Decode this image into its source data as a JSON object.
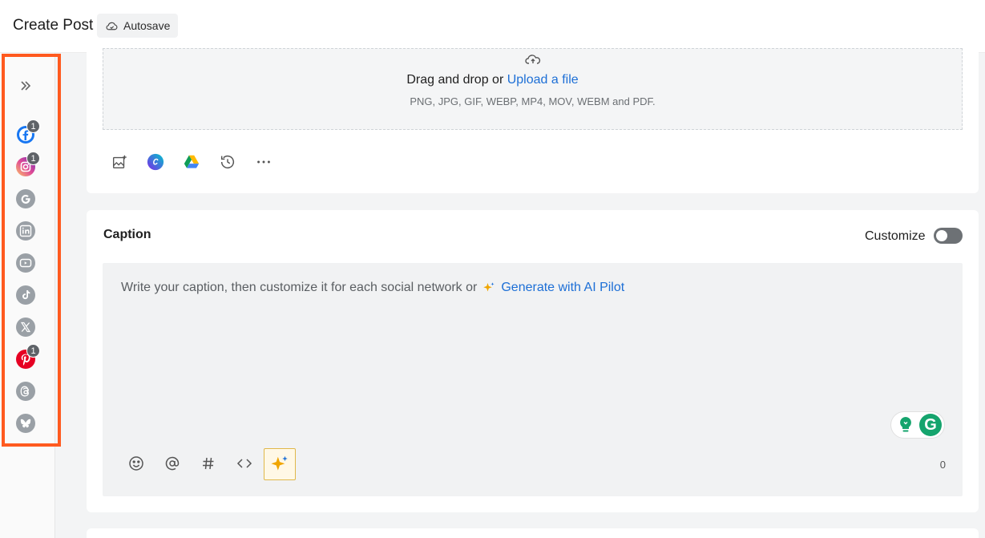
{
  "header": {
    "title": "Create Post",
    "autosave_label": "Autosave"
  },
  "sidebar": {
    "networks": [
      {
        "name": "facebook-icon",
        "badge": "1",
        "color": "#1877f2"
      },
      {
        "name": "instagram-icon",
        "badge": "1",
        "color": "#e1306c"
      },
      {
        "name": "google-icon",
        "badge": "",
        "color": "#9aa0a6"
      },
      {
        "name": "linkedin-icon",
        "badge": "",
        "color": "#9aa0a6"
      },
      {
        "name": "youtube-icon",
        "badge": "",
        "color": "#9aa0a6"
      },
      {
        "name": "tiktok-icon",
        "badge": "",
        "color": "#9aa0a6"
      },
      {
        "name": "x-icon",
        "badge": "",
        "color": "#9aa0a6"
      },
      {
        "name": "pinterest-icon",
        "badge": "1",
        "color": "#e60023"
      },
      {
        "name": "threads-icon",
        "badge": "",
        "color": "#9aa0a6"
      },
      {
        "name": "bluesky-icon",
        "badge": "",
        "color": "#9aa0a6"
      }
    ]
  },
  "upload": {
    "drag_text": "Drag and drop or ",
    "upload_link": "Upload a file",
    "formats": "PNG, JPG, GIF, WEBP, MP4, MOV, WEBM and PDF."
  },
  "caption": {
    "label": "Caption",
    "customize_label": "Customize",
    "placeholder_text": "Write your caption, then customize it for each social network or",
    "ai_link": "Generate with AI Pilot",
    "char_count": "0"
  },
  "colors": {
    "accent_link": "#1d6fd6",
    "highlight_border": "#ff5a1f",
    "ai_spark": "#f0a500"
  }
}
